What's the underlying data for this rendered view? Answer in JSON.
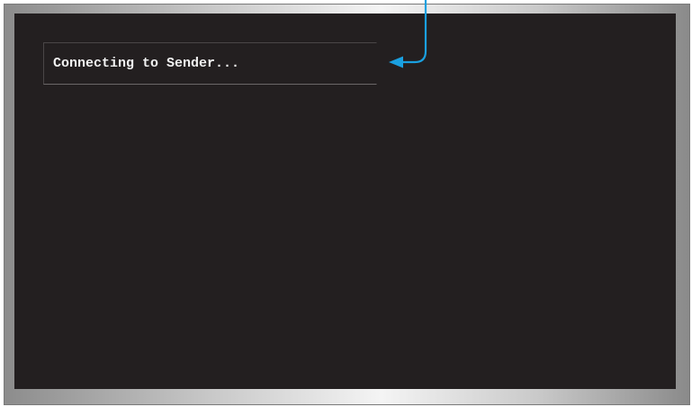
{
  "screen": {
    "status_message": "Connecting to Sender..."
  },
  "colors": {
    "screen_background": "#231f20",
    "text": "#f2f2f2",
    "callout_arrow": "#1aa0e0"
  }
}
